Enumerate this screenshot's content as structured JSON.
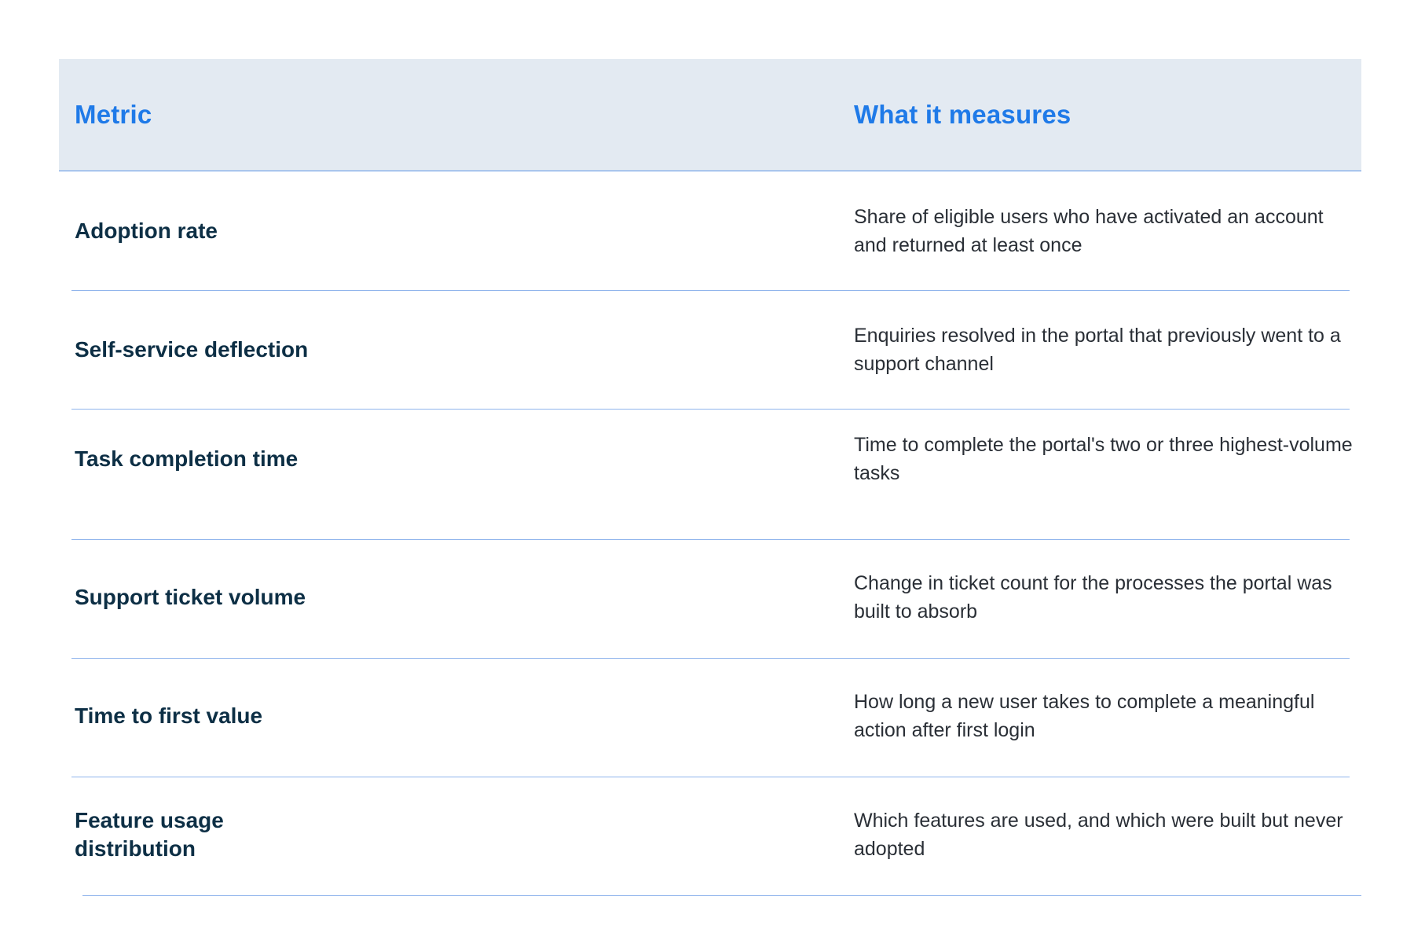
{
  "table": {
    "headers": {
      "metric": "Metric",
      "measures": "What it measures"
    },
    "rows": [
      {
        "metric": "Adoption rate",
        "measure": "Share of eligible users who have activated an account and returned at least once"
      },
      {
        "metric": "Self-service deflection",
        "measure": "Enquiries resolved in the portal that previously went to a support channel"
      },
      {
        "metric": "Task completion time",
        "measure": "Time to complete the portal's two or three highest-volume tasks"
      },
      {
        "metric": "Support ticket volume",
        "measure": "Change in ticket count for the processes the portal was built to absorb"
      },
      {
        "metric": "Time to first value",
        "measure": "How long a new user takes to complete a meaningful action after first login"
      },
      {
        "metric": "Feature usage distribution",
        "measure": "Which features are used, and which were built but never adopted"
      }
    ]
  }
}
